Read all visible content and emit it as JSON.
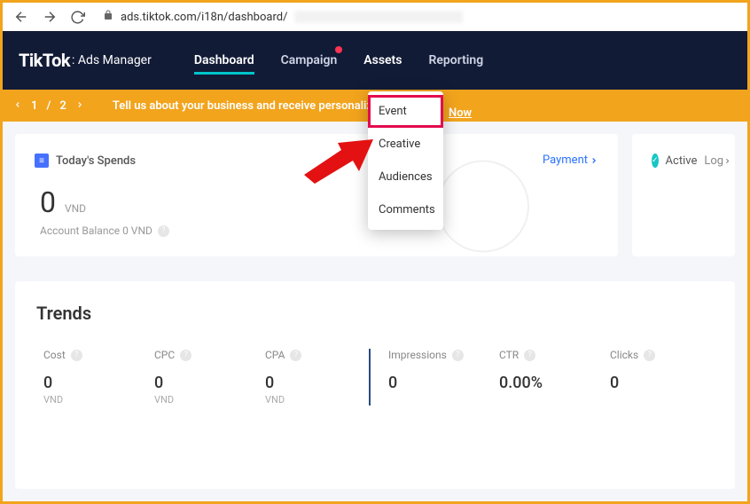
{
  "browser": {
    "url_host": "ads.tiktok.com",
    "url_path": "/i18n/dashboard/"
  },
  "nav": {
    "brand": "TikTok",
    "brand_suffix": ": Ads Manager",
    "links": {
      "dashboard": "Dashboard",
      "campaign": "Campaign",
      "assets": "Assets",
      "reporting": "Reporting"
    }
  },
  "promo": {
    "count_a": "1",
    "slash": "/",
    "count_b": "2",
    "text": "Tell us about your business and receive personalize",
    "link_visible": "Now"
  },
  "assets_menu": {
    "event": "Event",
    "creative": "Creative",
    "audiences": "Audiences",
    "comments": "Comments"
  },
  "spend_card": {
    "title": "Today's Spends",
    "value": "0",
    "unit": "VND",
    "balance_label": "Account Balance 0 VND",
    "payment_link": "Payment"
  },
  "status_card": {
    "status": "Active",
    "log_link": "Log"
  },
  "trends": {
    "title": "Trends",
    "cols": [
      {
        "label": "Cost",
        "value": "0",
        "unit": "VND"
      },
      {
        "label": "CPC",
        "value": "0",
        "unit": "VND"
      },
      {
        "label": "CPA",
        "value": "0",
        "unit": "VND"
      },
      {
        "label": "Impressions",
        "value": "0",
        "unit": ""
      },
      {
        "label": "CTR",
        "value": "0.00%",
        "unit": ""
      },
      {
        "label": "Clicks",
        "value": "0",
        "unit": ""
      }
    ]
  }
}
